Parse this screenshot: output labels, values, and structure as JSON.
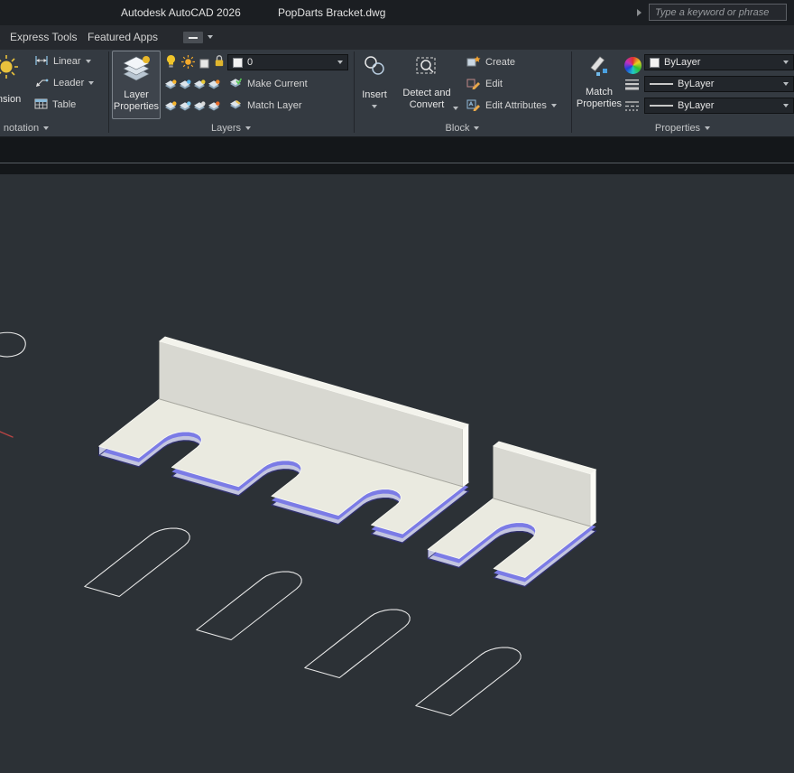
{
  "title_bar": {
    "app_title": "Autodesk AutoCAD 2026",
    "doc_title": "PopDarts Bracket.dwg",
    "search_placeholder": "Type a keyword or phrase"
  },
  "menu": {
    "express_tools": "Express Tools",
    "featured_apps": "Featured Apps"
  },
  "ribbon": {
    "annotation": {
      "dimension_partial": "ension",
      "linear": "Linear",
      "leader": "Leader",
      "table": "Table",
      "label": "notation"
    },
    "layers": {
      "big_line1": "Layer",
      "big_line2": "Properties",
      "current_layer": "0",
      "make_current": "Make Current",
      "match_layer": "Match Layer",
      "label": "Layers"
    },
    "block": {
      "insert": "Insert",
      "detect_line1": "Detect and",
      "detect_line2": "Convert",
      "create": "Create",
      "edit": "Edit",
      "edit_attributes": "Edit Attributes",
      "label": "Block"
    },
    "properties": {
      "big_line1": "Match",
      "big_line2": "Properties",
      "color_value": "ByLayer",
      "lineweight_value": "ByLayer",
      "linetype_value": "ByLayer",
      "label": "Properties"
    }
  },
  "drawing": {
    "background": "#2c3136",
    "face_top": "#eaeae0",
    "face_wall": "#d8d8d1",
    "face_wall_top": "#f3f3ec",
    "face_wall_end": "#fbfbf5",
    "edge_blue": "#7b7be6",
    "edge_light": "#c3c5df",
    "edge_dark": "#30306e",
    "edge_white": "#f8f8f2",
    "wall_base_line": "#a8a8a0",
    "wire": "#e8e8e8",
    "red_mark": "#b84444"
  }
}
